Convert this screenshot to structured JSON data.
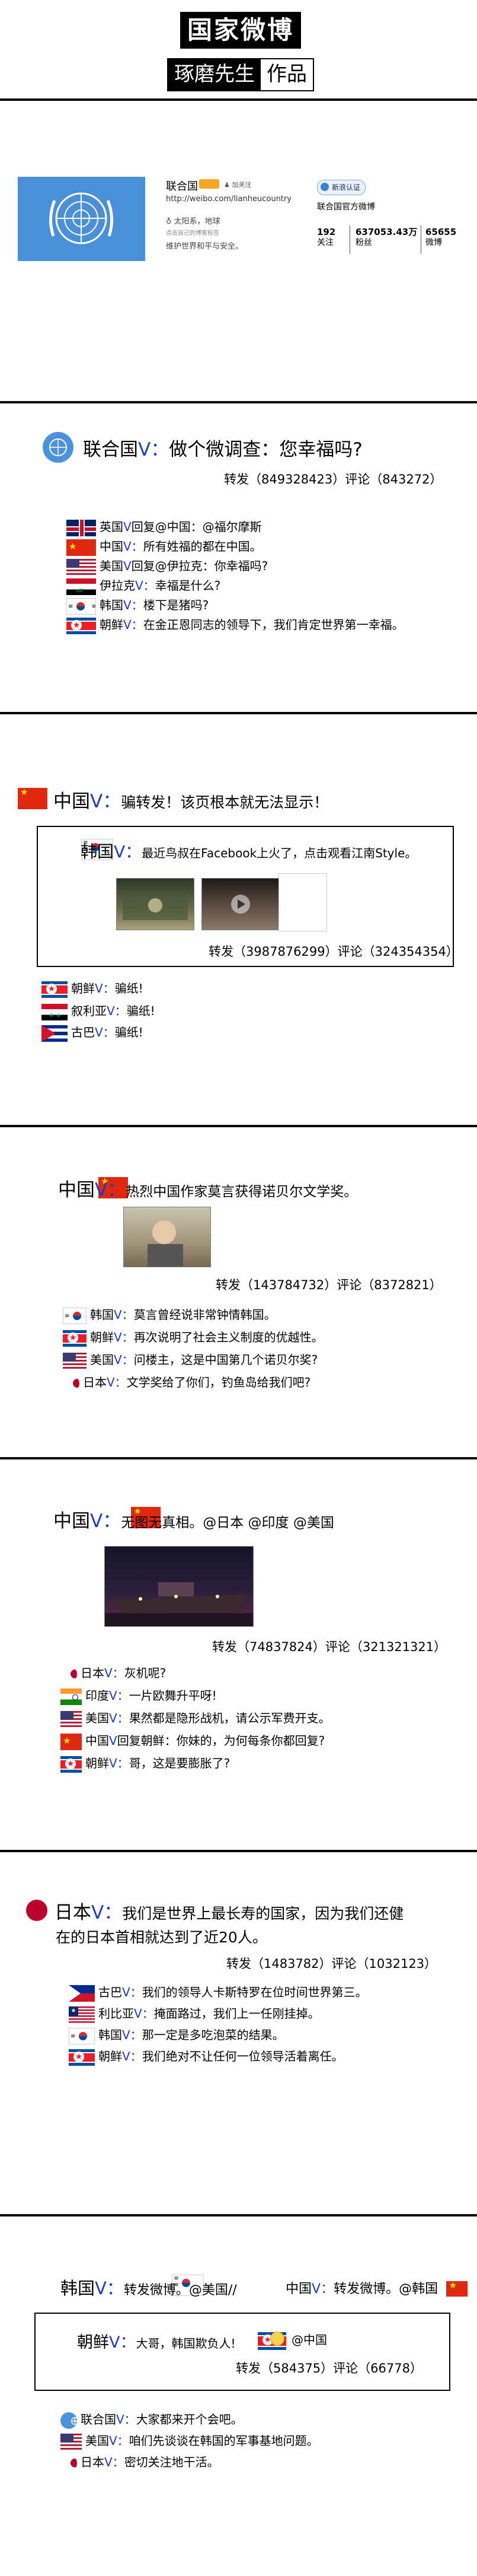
{
  "header": {
    "title": "国家微博",
    "author": "琢磨先生",
    "suffix": "作品"
  },
  "profile": {
    "name": "联合国",
    "url": "http://weibo.com/lianheucountry",
    "location": "太阳系，地球",
    "line2": "点击自己的博客标签",
    "line3": "维护世界和平与安全。",
    "badge": "新浪认证",
    "desc": "联合国官方微博",
    "follow_count": "192",
    "follow_label": "关注",
    "fans_count": "637053.43万",
    "fans_label": "粉丝",
    "weibo_count": "65655",
    "weibo_label": "微博"
  },
  "posts": [
    {
      "author": "联合国",
      "v": "V：",
      "text": "做个微调查：您幸福吗?",
      "meta": "转发（849328423）评论（843272）",
      "replies": [
        {
          "flag": "gb",
          "who": "英国",
          "v": "V",
          "text": "回复@中国：@福尔摩斯"
        },
        {
          "flag": "cn",
          "who": "中国",
          "v": "V：",
          "text": "所有姓福的都在中国。"
        },
        {
          "flag": "us",
          "who": "美国",
          "v": "V",
          "text": "回复@伊拉克：你幸福吗?"
        },
        {
          "flag": "iq",
          "who": "伊拉克",
          "v": "V：",
          "text": "幸福是什么?"
        },
        {
          "flag": "kr",
          "who": "韩国",
          "v": "V：",
          "text": "楼下是猪吗?"
        },
        {
          "flag": "kp",
          "who": "朝鲜",
          "v": "V：",
          "text": "在金正恩同志的领导下，我们肯定世界第一幸福。"
        }
      ]
    },
    {
      "author": "中国",
      "v": "V：",
      "text": "骗转发！该页根本就无法显示！",
      "quoted": {
        "author": "韩国",
        "v": "V：",
        "text": "最近鸟叔在Facebook上火了，点击观看江南Style。",
        "meta": "转发（3987876299）评论（324354354）"
      },
      "replies": [
        {
          "flag": "kp",
          "who": "朝鲜",
          "v": "V：",
          "text": "骗纸!"
        },
        {
          "flag": "sy",
          "who": "叙利亚",
          "v": "V：",
          "text": "骗纸!"
        },
        {
          "flag": "cu",
          "who": "古巴",
          "v": "V：",
          "text": "骗纸!"
        }
      ]
    },
    {
      "author": "中国",
      "v": "V：",
      "text": "热烈中国作家莫言获得诺贝尔文学奖。",
      "meta": "转发（143784732）评论（8372821）",
      "replies": [
        {
          "flag": "kr",
          "who": "韩国",
          "v": "V：",
          "text": "莫言曾经说非常钟情韩国。"
        },
        {
          "flag": "kp",
          "who": "朝鲜",
          "v": "V：",
          "text": "再次说明了社会主义制度的优越性。"
        },
        {
          "flag": "us",
          "who": "美国",
          "v": "V：",
          "text": "问楼主，这是中国第几个诺贝尔奖?"
        },
        {
          "flag": "jp",
          "who": "日本",
          "v": "V：",
          "text": "文学奖给了你们，钓鱼岛给我们吧?"
        }
      ]
    },
    {
      "author": "中国",
      "v": "V：",
      "text": "无图无真相。@日本 @印度 @美国",
      "meta": "转发（74837824）评论（321321321）",
      "replies": [
        {
          "flag": "jp",
          "who": "日本",
          "v": "V：",
          "text": "灰机呢?"
        },
        {
          "flag": "in",
          "who": "印度",
          "v": "V：",
          "text": "一片欧舞升平呀!"
        },
        {
          "flag": "us",
          "who": "美国",
          "v": "V：",
          "text": "果然都是隐形战机，请公示军费开支。"
        },
        {
          "flag": "cn",
          "who": "中国",
          "v": "V",
          "text": "回复朝鲜：你妹的，为何每条你都回复?"
        },
        {
          "flag": "kp",
          "who": "朝鲜",
          "v": "V：",
          "text": "哥，这是要膨胀了?"
        }
      ]
    },
    {
      "author": "日本",
      "v": "V：",
      "text": "我们是世界上最长寿的国家，因为我们还健",
      "text2": "在的日本首相就达到了近20人。",
      "meta": "转发（1483782）评论（1032123）",
      "replies": [
        {
          "flag": "cb",
          "who": "古巴",
          "v": "V：",
          "text": "我们的领导人卡斯特罗在位时间世界第三。"
        },
        {
          "flag": "lr",
          "who": "利比亚",
          "v": "V：",
          "text": "掩面路过，我们上一任刚挂掉。"
        },
        {
          "flag": "kr",
          "who": "韩国",
          "v": "V：",
          "text": "那一定是多吃泡菜的结果。"
        },
        {
          "flag": "kp",
          "who": "朝鲜",
          "v": "V：",
          "text": "我们绝对不让任何一位领导活着离任。"
        }
      ]
    },
    {
      "author": "韩国",
      "v": "V：",
      "text": "转发微博。@美国//",
      "text_b_who": "中国",
      "text_b_v": "V：",
      "text_b": "转发微博。@韩国",
      "quoted": {
        "author": "朝鲜",
        "v": "V：",
        "text": "大哥，韩国欺负人!",
        "mention": "@中国",
        "meta": "转发（584375）评论（66778）"
      },
      "replies": [
        {
          "flag": "un",
          "who": "联合国",
          "v": "V：",
          "text": "大家都来开个会吧。"
        },
        {
          "flag": "us",
          "who": "美国",
          "v": "V：",
          "text": "咱们先谈谈在韩国的军事基地问题。"
        },
        {
          "flag": "jp",
          "who": "日本",
          "v": "V：",
          "text": "密切关注地干活。"
        }
      ]
    }
  ]
}
